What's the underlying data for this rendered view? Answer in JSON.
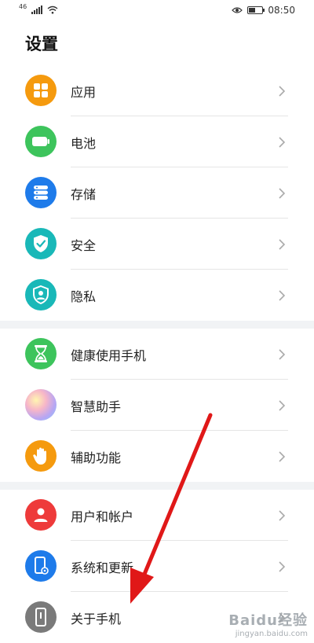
{
  "status_bar": {
    "network": "46",
    "time": "08:50"
  },
  "page": {
    "title": "设置"
  },
  "groups": [
    {
      "items": [
        {
          "label": "应用",
          "icon": "apps-grid-icon",
          "color": "#F59A0E"
        },
        {
          "label": "电池",
          "icon": "battery-icon",
          "color": "#3DC45C"
        },
        {
          "label": "存储",
          "icon": "storage-icon",
          "color": "#1E7BEA"
        },
        {
          "label": "安全",
          "icon": "shield-check-icon",
          "color": "#19B8B8"
        },
        {
          "label": "隐私",
          "icon": "privacy-shield-icon",
          "color": "#19B8B8"
        }
      ]
    },
    {
      "items": [
        {
          "label": "健康使用手机",
          "icon": "hourglass-icon",
          "color": "#3DC45C"
        },
        {
          "label": "智慧助手",
          "icon": "assistant-orb-icon",
          "color": "#c9a2e6"
        },
        {
          "label": "辅助功能",
          "icon": "hand-icon",
          "color": "#F59A0E"
        }
      ]
    },
    {
      "items": [
        {
          "label": "用户和帐户",
          "icon": "user-icon",
          "color": "#EE3A3A"
        },
        {
          "label": "系统和更新",
          "icon": "system-phone-icon",
          "color": "#1E7BEA"
        },
        {
          "label": "关于手机",
          "icon": "phone-info-icon",
          "color": "#7A7A7A"
        }
      ]
    }
  ],
  "watermark": {
    "logo": "Baidu经验",
    "url": "jingyan.baidu.com"
  },
  "colors": {
    "arrow": "#E01818",
    "section_gap": "#F1F3F5"
  }
}
